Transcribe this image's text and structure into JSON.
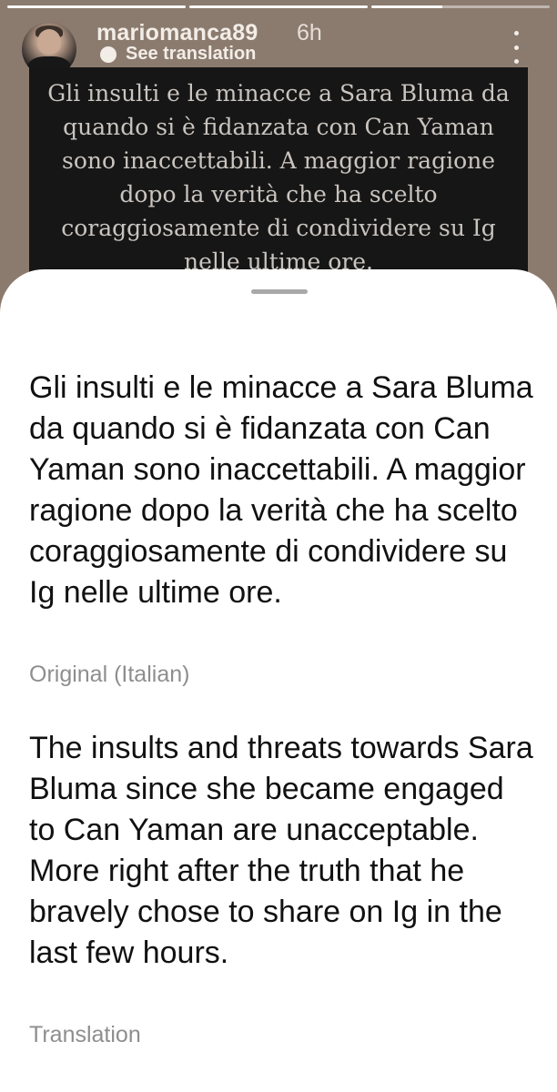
{
  "story": {
    "username": "mariomanca89",
    "timestamp": "6h",
    "see_translation": "See translation",
    "text": "Gli insulti e le minacce a Sara Bluma da quando si è fidanzata con Can Yaman sono inaccettabili. A maggior ragione dopo la verità che ha scelto coraggiosamente di condividere su Ig nelle ultime ore.",
    "progress": [
      1.0,
      1.0,
      0.4
    ],
    "colors": {
      "background": "#8b7b6e",
      "card": "#161616",
      "card_text": "#c9c4bf"
    }
  },
  "icons": {
    "translate": "translate-icon",
    "more": "more-options-icon"
  },
  "sheet": {
    "original_text": "Gli insulti e le minacce a Sara Bluma da quando si è fidanzata con Can Yaman sono inaccettabili. A maggior ragione dopo la verità che ha scelto coraggiosamente di condividere su Ig nelle ultime ore.",
    "original_label": "Original (Italian)",
    "translation_text": "The insults and threats towards Sara Bluma since she became engaged to Can Yaman are unacceptable. More right after the truth that he bravely chose to share on Ig in the last few hours.",
    "translation_label": "Translation"
  }
}
